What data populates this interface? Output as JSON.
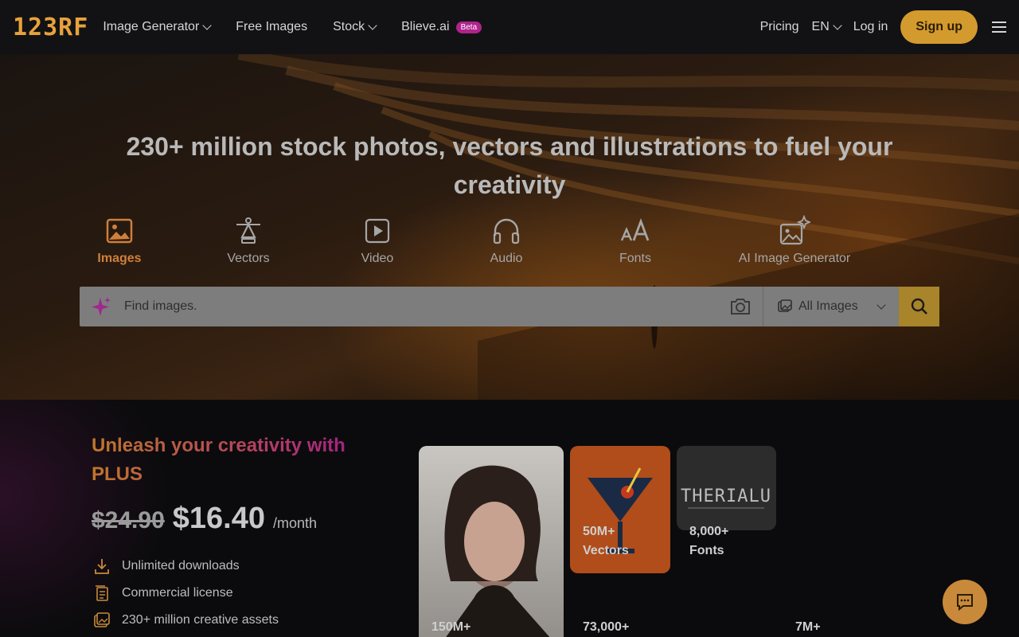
{
  "nav": {
    "logo": "123RF",
    "items": [
      {
        "label": "Image Generator",
        "dropdown": true
      },
      {
        "label": "Free Images",
        "dropdown": false
      },
      {
        "label": "Stock",
        "dropdown": true
      },
      {
        "label": "Blieve.ai",
        "badge": "Beta"
      }
    ],
    "pricing": "Pricing",
    "language": "EN",
    "login": "Log in",
    "signup": "Sign up"
  },
  "hero": {
    "title": "230+ million stock photos, vectors and illustrations to fuel your creativity",
    "tabs": [
      {
        "label": "Images",
        "icon": "image-icon",
        "active": true
      },
      {
        "label": "Vectors",
        "icon": "pen-tool-icon",
        "active": false
      },
      {
        "label": "Video",
        "icon": "play-icon",
        "active": false
      },
      {
        "label": "Audio",
        "icon": "headphones-icon",
        "active": false
      },
      {
        "label": "Fonts",
        "icon": "font-size-icon",
        "active": false
      },
      {
        "label": "AI Image Generator",
        "icon": "ai-image-icon",
        "active": false
      }
    ],
    "search": {
      "placeholder": "Find images.",
      "filter_value": "All Images"
    }
  },
  "promo": {
    "title": "Unleash your creativity with PLUS",
    "old_price": "$24.90",
    "new_price": "$16.40",
    "period": "/month",
    "features": [
      "Unlimited downloads",
      "Commercial license",
      "230+ million creative assets"
    ],
    "stats": [
      {
        "count": "150M+",
        "label": ""
      },
      {
        "count": "50M+",
        "label": "Vectors"
      },
      {
        "count": "8,000+",
        "label": "Fonts"
      },
      {
        "count": "73,000+",
        "label": ""
      },
      {
        "count": "7M+",
        "label": ""
      }
    ],
    "font_card_text": "THERIALU"
  },
  "colors": {
    "accent": "#d39a2e",
    "active_tab": "#d07f3a",
    "brand": "#e7a23c"
  }
}
